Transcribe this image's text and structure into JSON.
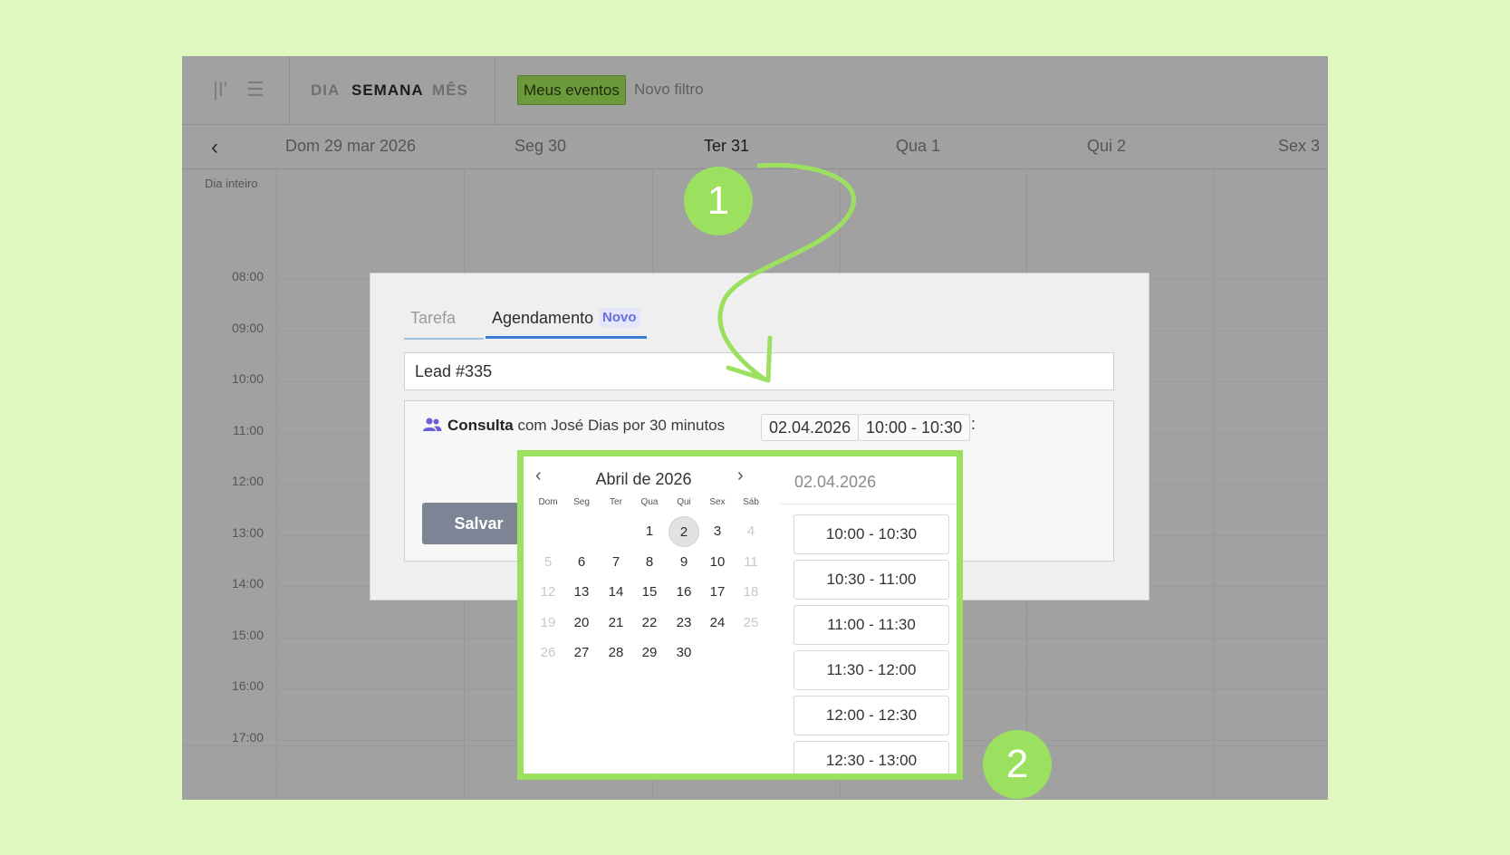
{
  "toolbar": {
    "views": [
      "DIA",
      "SEMANA",
      "MÊS"
    ],
    "active_view": "SEMANA",
    "filter_chip": "Meus eventos",
    "new_filter": "Novo filtro"
  },
  "week_header": {
    "days": [
      "Dom 29 mar 2026",
      "Seg 30",
      "Ter 31",
      "Qua 1",
      "Qui 2",
      "Sex 3"
    ],
    "today": "Ter 31"
  },
  "grid": {
    "allday_label": "Dia inteiro",
    "hours": [
      "08:00",
      "09:00",
      "10:00",
      "11:00",
      "12:00",
      "13:00",
      "14:00",
      "15:00",
      "16:00",
      "17:00"
    ]
  },
  "modal": {
    "tabs": [
      "Tarefa",
      "Agendamento"
    ],
    "new_badge": "Novo",
    "title_value": "Lead #335",
    "booking": {
      "service": "Consulta",
      "details": "com José Dias por 30 minutos",
      "date": "02.04.2026",
      "time": "10:00 - 10:30",
      "colon": ":"
    },
    "save_label": "Salvar"
  },
  "picker": {
    "month_title": "Abril de 2026",
    "weekdays": [
      "Dom",
      "Seg",
      "Ter",
      "Qua",
      "Qui",
      "Sex",
      "Sáb"
    ],
    "first_weekday_index": 3,
    "days_in_month": 30,
    "selected_day": 2,
    "disabled_weekday_indexes": [
      0,
      6
    ],
    "selected_date_label": "02.04.2026",
    "slots": [
      "10:00 - 10:30",
      "10:30 - 11:00",
      "11:00 - 11:30",
      "11:30 - 12:00",
      "12:00 - 12:30",
      "12:30 - 13:00"
    ]
  },
  "annotations": {
    "step1": "1",
    "step2": "2",
    "accent_color": "#9be15f"
  }
}
